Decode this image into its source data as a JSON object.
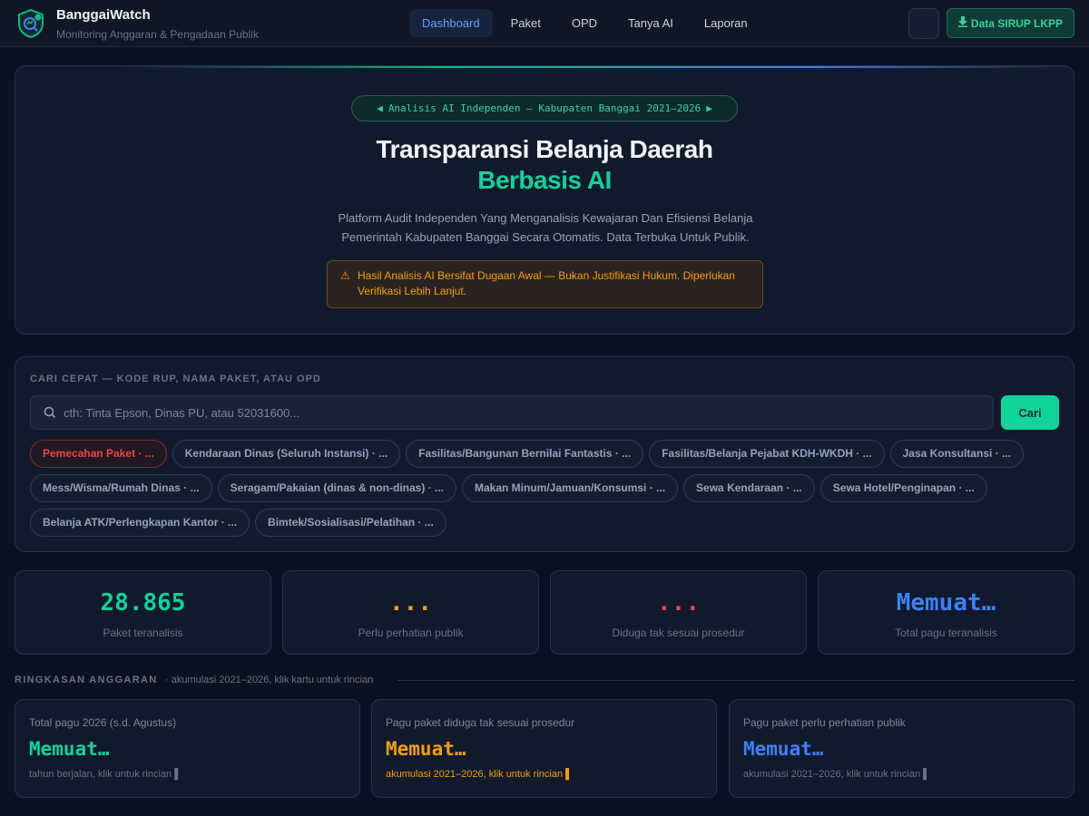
{
  "header": {
    "brand_title": "BanggaiWatch",
    "brand_subtitle": "Monitoring Anggaran & Pengadaan Publik",
    "nav": [
      "Dashboard",
      "Paket",
      "OPD",
      "Tanya AI",
      "Laporan"
    ],
    "active_nav": "Dashboard",
    "data_button": "Data SIRUP LKPP",
    "data_button_icon": "download-icon"
  },
  "hero": {
    "pill": "Analisis AI Independen — Kabupaten Banggai 2021–2026",
    "title_line1": "Transparansi Belanja Daerah",
    "title_line2": "Berbasis AI",
    "description": "Platform Audit Independen Yang Menganalisis Kewajaran Dan Efisiensi Belanja Pemerintah Kabupaten Banggai Secara Otomatis. Data Terbuka Untuk Publik.",
    "warning": "Hasil Analisis AI Bersifat Dugaan Awal — Bukan Justifikasi Hukum. Diperlukan Verifikasi Lebih Lanjut."
  },
  "search": {
    "label": "CARI CEPAT — KODE RUP, NAMA PAKET, ATAU OPD",
    "placeholder": "cth: Tinta Epson, Dinas PU, atau 52031600...",
    "value": "",
    "button": "Cari",
    "chips_row1": [
      "Pemecahan Paket · ...",
      "Kendaraan Dinas (Seluruh Instansi) · ...",
      "Fasilitas/Bangunan Bernilai Fantastis · ...",
      "Fasilitas/Belanja Pejabat KDH-WKDH · ...",
      "Jasa Konsultansi · ..."
    ],
    "chips_row2": [
      "Mess/Wisma/Rumah Dinas · ...",
      "Seragam/Pakaian (dinas & non-dinas) · ...",
      "Makan Minum/Jamuan/Konsumsi · ...",
      "Sewa Kendaraan · ...",
      "Sewa Hotel/Penginapan · ..."
    ],
    "chips_row3": [
      "Belanja ATK/Perlengkapan Kantor · ...",
      "Bimtek/Sosialisasi/Pelatihan · ..."
    ]
  },
  "stats": [
    {
      "value": "28.865",
      "label": "Paket teranalisis",
      "color": "#10d39a"
    },
    {
      "value": "...",
      "label": "Perlu perhatian publik",
      "color": "#f59e0b"
    },
    {
      "value": "...",
      "label": "Diduga tak sesuai prosedur",
      "color": "#ef4444"
    },
    {
      "value": "Memuat…",
      "label": "Total pagu teranalisis",
      "color": "#3b82f6"
    }
  ],
  "summary": {
    "title": "RINGKASAN ANGGARAN",
    "subtitle": "· akumulasi 2021–2026, klik kartu untuk rincian",
    "cards": [
      {
        "label": "Total pagu 2026 (s.d. Agustus)",
        "value": "Memuat…",
        "note": "tahun berjalan, klik untuk rincian ▌",
        "color": "#10d39a",
        "note_color": "#64748b"
      },
      {
        "label": "Pagu paket diduga tak sesuai prosedur",
        "value": "Memuat…",
        "note": "akumulasi 2021–2026, klik untuk rincian ▌",
        "color": "#f59e0b",
        "note_color": "#f59e0b"
      },
      {
        "label": "Pagu paket perlu perhatian publik",
        "value": "Memuat…",
        "note": "akumulasi 2021–2026, klik untuk rincian ▌",
        "color": "#3b82f6",
        "note_color": "#64748b"
      }
    ]
  }
}
